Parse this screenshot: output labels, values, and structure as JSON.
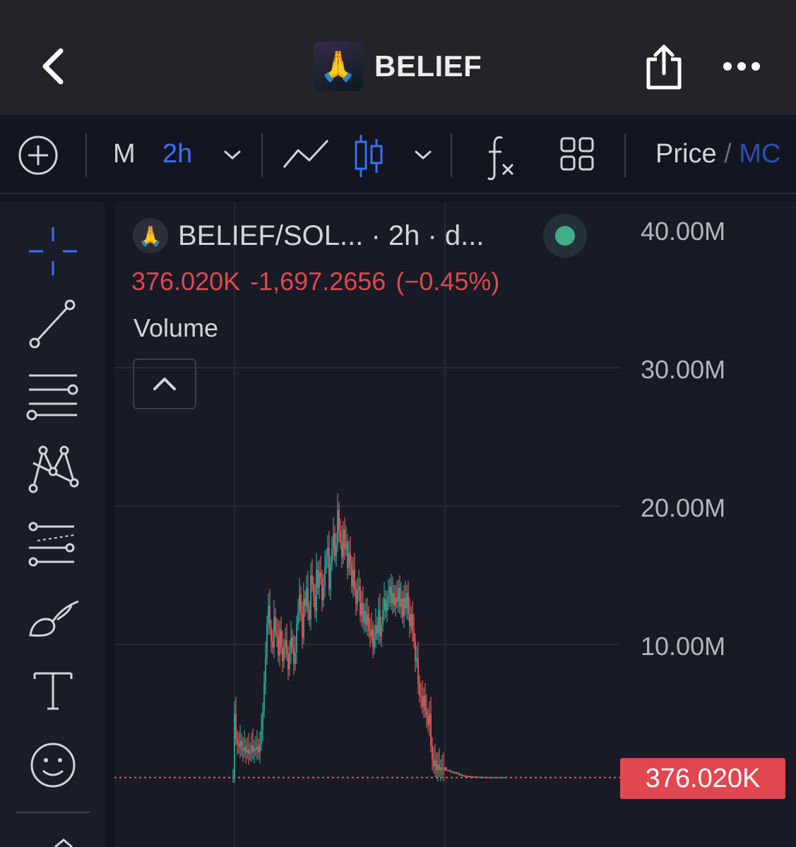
{
  "header": {
    "title": "BELIEF",
    "app_icon": "🙏",
    "back_icon": "chevron-left-icon",
    "share_icon": "share-icon",
    "more_icon": "more-horizontal-icon"
  },
  "toolbar": {
    "add_icon": "plus-circle-icon",
    "interval_m": "M",
    "interval_selected": "2h",
    "interval_dropdown_icon": "chevron-down-icon",
    "line_chart_icon": "line-chart-icon",
    "candle_icon": "candlestick-icon",
    "chart_type_dropdown_icon": "chevron-down-icon",
    "indicators_icon": "fx-icon",
    "layout_icon": "grid-icon",
    "price_label": "Price",
    "separator": "/",
    "mc_label": "MC"
  },
  "sidebar": {
    "tools": [
      "crosshair-icon",
      "trend-line-icon",
      "horizontal-lines-icon",
      "pattern-icon",
      "fib-icon",
      "brush-icon",
      "text-icon",
      "emoji-icon"
    ]
  },
  "legend": {
    "icon": "🙏",
    "symbol": "BELIEF/SOL... · 2h · d...",
    "last_value": "376.020K",
    "change": "-1,697.2656",
    "change_pct": "(−0.45%)",
    "volume_label": "Volume",
    "collapse_icon": "chevron-up-icon"
  },
  "colors": {
    "up": "#26a69a",
    "down": "#ef5350",
    "accent": "#3a6ff7",
    "status": "#3fae87",
    "price_tag": "#e0474f"
  },
  "chart_data": {
    "type": "candlestick",
    "y_axis_labels": [
      "40.00M",
      "30.00M",
      "20.00M",
      "10.00M"
    ],
    "ylim": [
      0,
      40000000
    ],
    "last_price_label": "376.020K",
    "last_price": 376020,
    "grid": true,
    "x": [
      0,
      1,
      2,
      3,
      4,
      5,
      6,
      7,
      8,
      9,
      10,
      11,
      12,
      13,
      14,
      15,
      16,
      17,
      18,
      19,
      20,
      21,
      22,
      23,
      24,
      25,
      26,
      27,
      28,
      29,
      30,
      31,
      32,
      33,
      34,
      35,
      36,
      37,
      38,
      39,
      40,
      41,
      42,
      43,
      44,
      45,
      46,
      47,
      48,
      49,
      50,
      51,
      52,
      53,
      54,
      55,
      56,
      57,
      58,
      59,
      60,
      61,
      62,
      63,
      64,
      65,
      66,
      67,
      68,
      69,
      70,
      71,
      72,
      73,
      74,
      75,
      76,
      77,
      78,
      79,
      80,
      81,
      82,
      83,
      84,
      85,
      86,
      87,
      88,
      89,
      90,
      91,
      92,
      93,
      94,
      95,
      96,
      97,
      98,
      99,
      100,
      101,
      102,
      103,
      104,
      105,
      106,
      107,
      108,
      109,
      110,
      111,
      112,
      113,
      114,
      115,
      116,
      117,
      118,
      119,
      120,
      121,
      122,
      123,
      124,
      125,
      126,
      127,
      128,
      129,
      130,
      131,
      132,
      133,
      134,
      135,
      136,
      137,
      138,
      139,
      140,
      141,
      142,
      143,
      144,
      145,
      146,
      147,
      148,
      149,
      150,
      151,
      152,
      153,
      154,
      155,
      156,
      157,
      158,
      159,
      160,
      161,
      162,
      163,
      164,
      165,
      166,
      167,
      168,
      169,
      170,
      171,
      172,
      173,
      174,
      175,
      176,
      177,
      178,
      179,
      180,
      181,
      182,
      183,
      184,
      185,
      186,
      187,
      188,
      189,
      190,
      191,
      192,
      193
    ],
    "close": [
      0.4,
      5.0,
      3.2,
      2.8,
      2.6,
      3.0,
      2.4,
      2.3,
      2.6,
      2.2,
      2.4,
      2.1,
      2.3,
      2.7,
      2.2,
      2.5,
      2.4,
      2.6,
      2.2,
      2.8,
      3.8,
      5.2,
      7.2,
      9.0,
      11.5,
      12.8,
      11.2,
      10.2,
      9.8,
      12.0,
      11.0,
      10.6,
      9.2,
      11.1,
      9.8,
      8.8,
      9.8,
      10.3,
      9.3,
      8.2,
      9.4,
      10.5,
      9.8,
      8.6,
      9.4,
      11.5,
      12.4,
      13.6,
      12.2,
      10.5,
      13.3,
      12.8,
      14.1,
      12.5,
      11.8,
      15.0,
      14.3,
      13.5,
      12.4,
      15.4,
      14.1,
      15.2,
      14.8,
      13.2,
      14.2,
      15.6,
      16.3,
      17.0,
      14.0,
      15.8,
      16.9,
      18.0,
      16.4,
      17.2,
      19.7,
      18.2,
      17.4,
      16.3,
      18.3,
      16.9,
      17.4,
      15.5,
      16.6,
      15.8,
      14.2,
      15.4,
      14.0,
      12.9,
      13.9,
      14.2,
      12.1,
      13.0,
      11.6,
      12.4,
      11.4,
      12.2,
      11.0,
      10.6,
      11.1,
      9.8,
      10.5,
      11.4,
      10.8,
      12.5,
      10.6,
      11.4,
      12.5,
      13.3,
      12.4,
      13.0,
      13.5,
      14.2,
      13.0,
      13.7,
      12.8,
      13.4,
      13.1,
      14.1,
      12.7,
      13.3,
      12.0,
      13.4,
      12.6,
      13.7,
      12.2,
      11.3,
      12.2,
      11.0,
      10.2,
      8.8,
      9.0,
      7.2,
      6.3,
      6.2,
      5.5,
      6.3,
      5.2,
      4.8,
      4.2,
      5.0,
      2.7,
      1.7,
      1.2,
      1.6,
      0.9,
      1.3,
      0.9,
      1.1,
      1.0,
      0.9,
      1.1,
      0.9,
      0.85,
      0.9,
      0.75,
      0.8,
      0.7,
      0.75,
      0.65,
      0.7,
      0.55,
      0.6,
      0.5,
      0.52,
      0.45,
      0.48,
      0.42,
      0.46,
      0.4,
      0.43,
      0.38,
      0.42,
      0.39,
      0.41,
      0.38,
      0.4,
      0.37,
      0.39,
      0.38,
      0.38,
      0.38,
      0.376,
      0.376,
      0.376,
      0.376,
      0.376,
      0.376,
      0.376,
      0.376,
      0.376,
      0.376,
      0.376,
      0.376,
      0.376
    ]
  }
}
